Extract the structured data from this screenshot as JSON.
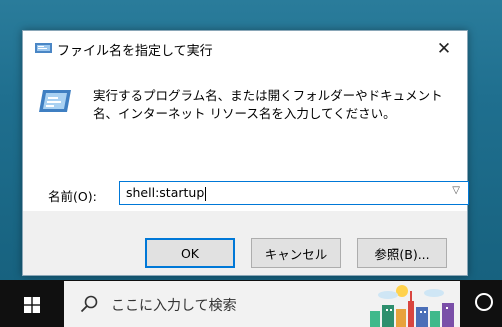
{
  "dialog": {
    "title": "ファイル名を指定して実行",
    "description": "実行するプログラム名、または開くフォルダーやドキュメント名、インターネット リソース名を入力してください。",
    "open_label": "名前(O):",
    "open_value": "shell:startup",
    "buttons": {
      "ok": "OK",
      "cancel": "キャンセル",
      "browse": "参照(B)..."
    },
    "icons": {
      "title": "run-icon",
      "close": "close-icon",
      "dropdown": "chevron-down-icon"
    }
  },
  "taskbar": {
    "search_placeholder": "ここに入力して検索",
    "icons": [
      "windows-start-icon",
      "search-icon",
      "cortana-icon"
    ]
  },
  "colors": {
    "desktop": "#1f6f91",
    "accent": "#0078d7",
    "taskbar": "#101010",
    "dialog_footer": "#f0f0f0"
  }
}
